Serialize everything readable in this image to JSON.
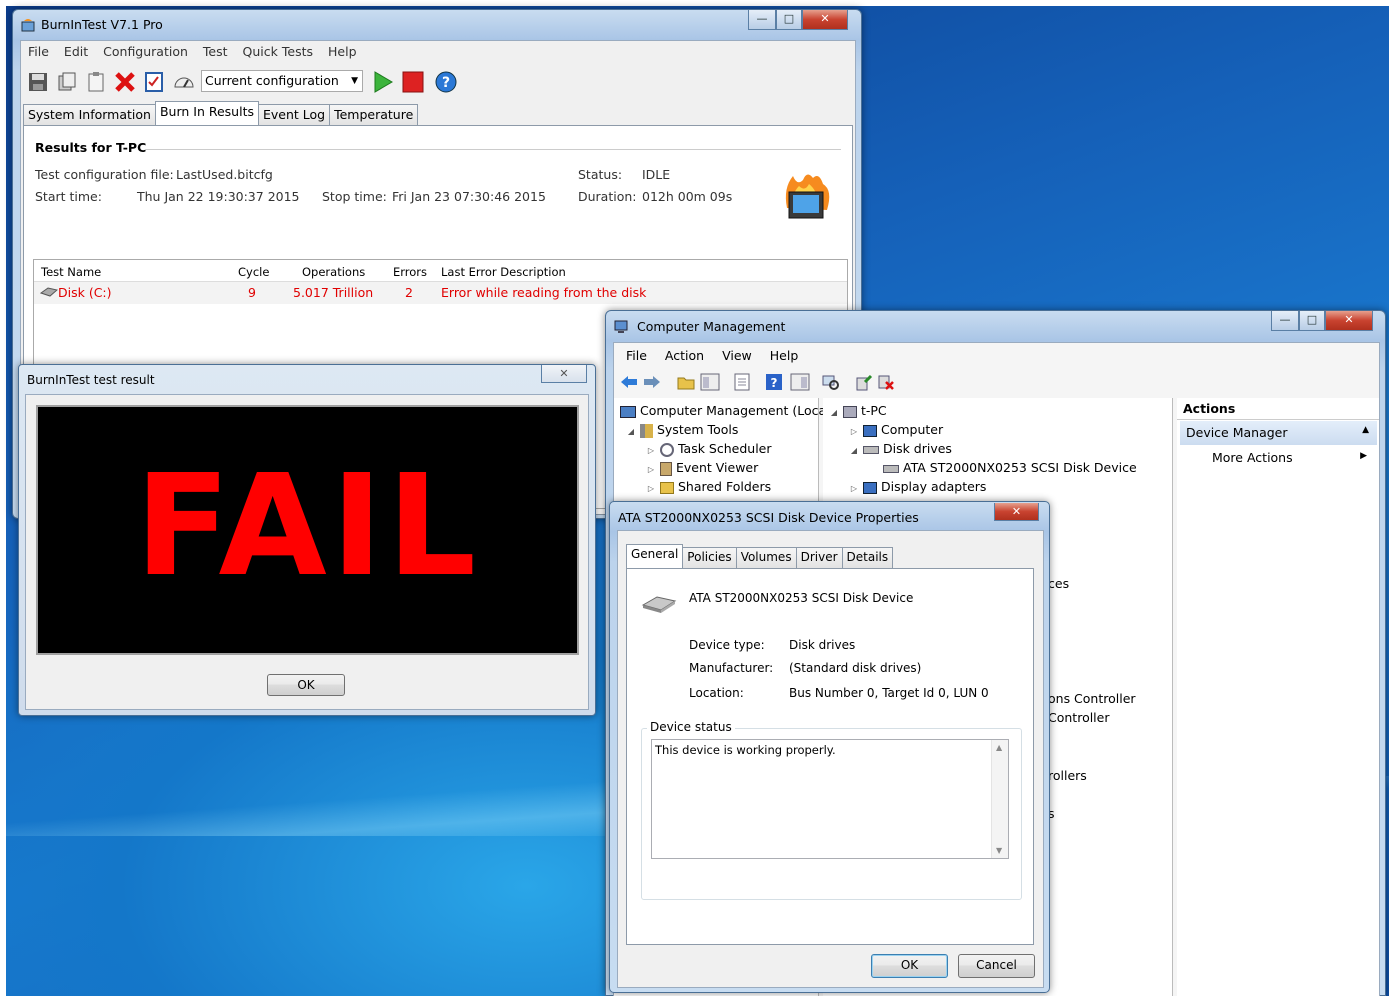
{
  "burnin": {
    "title": "BurnInTest V7.1 Pro",
    "menu": [
      "File",
      "Edit",
      "Configuration",
      "Test",
      "Quick Tests",
      "Help"
    ],
    "config_select": "Current configuration",
    "tabs": [
      "System Information",
      "Burn In Results",
      "Event Log",
      "Temperature"
    ],
    "results_heading": "Results for T-PC",
    "config_file_label": "Test configuration file:",
    "config_file_value": "LastUsed.bitcfg",
    "start_label": "Start time:",
    "start_value": "Thu Jan 22 19:30:37 2015",
    "stop_label": "Stop time:",
    "stop_value": "Fri Jan 23 07:30:46 2015",
    "status_label": "Status:",
    "status_value": "IDLE",
    "duration_label": "Duration:",
    "duration_value": "012h 00m 09s",
    "table": {
      "headers": [
        "Test Name",
        "Cycle",
        "Operations",
        "Errors",
        "Last Error Description"
      ],
      "rows": [
        {
          "name": "Disk (C:)",
          "cycle": "9",
          "operations": "5.017 Trillion",
          "errors": "2",
          "desc": "Error while reading from the disk"
        }
      ]
    },
    "colors": {
      "error": "#e00000"
    }
  },
  "result_dialog": {
    "title": "BurnInTest test result",
    "result_text": "FAIL",
    "ok": "OK",
    "colors": {
      "fail": "#ff0000",
      "panel": "#000000"
    }
  },
  "compmgmt": {
    "title": "Computer Management",
    "menu": [
      "File",
      "Action",
      "View",
      "Help"
    ],
    "left_tree": [
      {
        "label": "Computer Management (Local",
        "icon": "computer-icon"
      },
      {
        "label": "System Tools",
        "icon": "tools-icon"
      },
      {
        "label": "Task Scheduler",
        "icon": "clock-icon"
      },
      {
        "label": "Event Viewer",
        "icon": "event-viewer-icon"
      },
      {
        "label": "Shared Folders",
        "icon": "shared-folder-icon"
      }
    ],
    "right_tree": [
      {
        "label": "t-PC",
        "icon": "computer-icon"
      },
      {
        "label": "Computer",
        "icon": "monitor-icon"
      },
      {
        "label": "Disk drives",
        "icon": "disk-icon"
      },
      {
        "label": "ATA ST2000NX0253 SCSI Disk Device",
        "icon": "disk-icon"
      },
      {
        "label": "Display adapters",
        "icon": "display-adapter-icon"
      }
    ],
    "partial_items": [
      "ces",
      "ons Controller",
      "Controller",
      "rollers",
      "s"
    ],
    "actions": {
      "header": "Actions",
      "section": "Device Manager",
      "more": "More Actions"
    }
  },
  "props": {
    "title": "ATA ST2000NX0253 SCSI Disk Device Properties",
    "tabs": [
      "General",
      "Policies",
      "Volumes",
      "Driver",
      "Details"
    ],
    "device_name": "ATA ST2000NX0253 SCSI Disk Device",
    "type_label": "Device type:",
    "type_value": "Disk drives",
    "mfr_label": "Manufacturer:",
    "mfr_value": "(Standard disk drives)",
    "loc_label": "Location:",
    "loc_value": "Bus Number 0, Target Id 0, LUN 0",
    "status_group": "Device status",
    "status_text": "This device is working properly.",
    "ok": "OK",
    "cancel": "Cancel"
  }
}
